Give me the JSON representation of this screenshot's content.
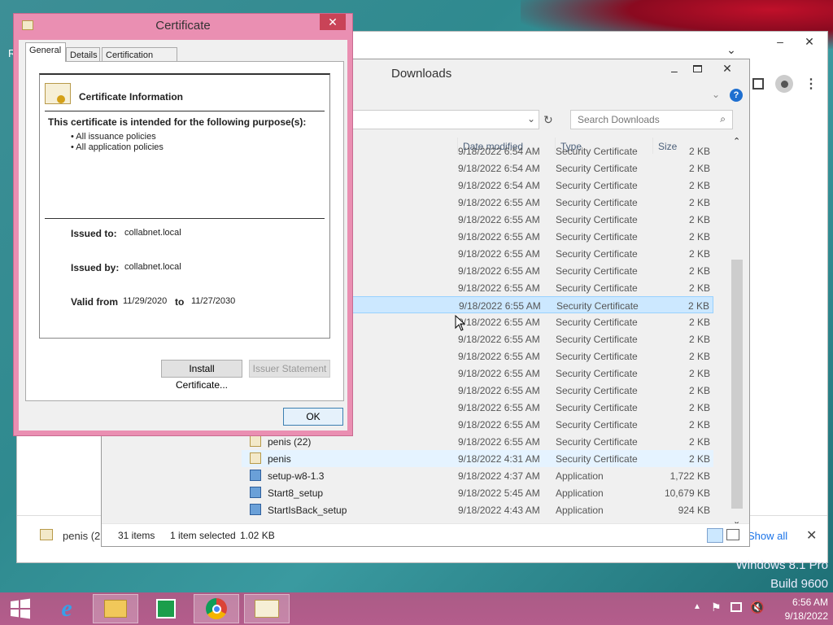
{
  "desktop": {
    "left_letter": "R",
    "edition": "Windows 8.1 Pro",
    "build": "Build 9600"
  },
  "chrome": {
    "download_shelf": {
      "file_name": "penis (2",
      "show_all": "Show all",
      "close": "✕"
    },
    "menu": "⋮"
  },
  "explorer": {
    "title": "Downloads",
    "search_placeholder": "Search Downloads",
    "columns": {
      "date": "Date modified",
      "type": "Type",
      "size": "Size"
    },
    "rows": [
      {
        "name": "",
        "date": "9/18/2022 6:54 AM",
        "type": "Security Certificate",
        "size": "2 KB"
      },
      {
        "name": "",
        "date": "9/18/2022 6:54 AM",
        "type": "Security Certificate",
        "size": "2 KB"
      },
      {
        "name": "",
        "date": "9/18/2022 6:54 AM",
        "type": "Security Certificate",
        "size": "2 KB"
      },
      {
        "name": "",
        "date": "9/18/2022 6:55 AM",
        "type": "Security Certificate",
        "size": "2 KB"
      },
      {
        "name": "",
        "date": "9/18/2022 6:55 AM",
        "type": "Security Certificate",
        "size": "2 KB"
      },
      {
        "name": "",
        "date": "9/18/2022 6:55 AM",
        "type": "Security Certificate",
        "size": "2 KB"
      },
      {
        "name": "",
        "date": "9/18/2022 6:55 AM",
        "type": "Security Certificate",
        "size": "2 KB"
      },
      {
        "name": "",
        "date": "9/18/2022 6:55 AM",
        "type": "Security Certificate",
        "size": "2 KB"
      },
      {
        "name": "",
        "date": "9/18/2022 6:55 AM",
        "type": "Security Certificate",
        "size": "2 KB"
      },
      {
        "name": "",
        "date": "9/18/2022 6:55 AM",
        "type": "Security Certificate",
        "size": "2 KB"
      },
      {
        "name": "",
        "date": "9/18/2022 6:55 AM",
        "type": "Security Certificate",
        "size": "2 KB"
      },
      {
        "name": "",
        "date": "9/18/2022 6:55 AM",
        "type": "Security Certificate",
        "size": "2 KB"
      },
      {
        "name": "",
        "date": "9/18/2022 6:55 AM",
        "type": "Security Certificate",
        "size": "2 KB"
      },
      {
        "name": "",
        "date": "9/18/2022 6:55 AM",
        "type": "Security Certificate",
        "size": "2 KB"
      },
      {
        "name": "",
        "date": "9/18/2022 6:55 AM",
        "type": "Security Certificate",
        "size": "2 KB"
      },
      {
        "name": "",
        "date": "9/18/2022 6:55 AM",
        "type": "Security Certificate",
        "size": "2 KB"
      },
      {
        "name": "",
        "date": "9/18/2022 6:55 AM",
        "type": "Security Certificate",
        "size": "2 KB"
      },
      {
        "name": "penis (22)",
        "date": "9/18/2022 6:55 AM",
        "type": "Security Certificate",
        "size": "2 KB"
      },
      {
        "name": "penis",
        "date": "9/18/2022 4:31 AM",
        "type": "Security Certificate",
        "size": "2 KB"
      },
      {
        "name": "setup-w8-1.3",
        "date": "9/18/2022 4:37 AM",
        "type": "Application",
        "size": "1,722 KB"
      },
      {
        "name": "Start8_setup",
        "date": "9/18/2022 5:45 AM",
        "type": "Application",
        "size": "10,679 KB"
      },
      {
        "name": "StartIsBack_setup",
        "date": "9/18/2022 4:43 AM",
        "type": "Application",
        "size": "924 KB"
      }
    ],
    "status": {
      "count": "31 items",
      "selection": "1 item selected",
      "size": "1.02 KB"
    }
  },
  "cert": {
    "title": "Certificate",
    "close": "✕",
    "tabs": [
      "General",
      "Details",
      "Certification Path"
    ],
    "heading": "Certificate Information",
    "purpose_heading": "This certificate is intended for the following purpose(s):",
    "purposes": [
      "• All issuance policies",
      "• All application policies"
    ],
    "issued_to_label": "Issued to:",
    "issued_to": "collabnet.local",
    "issued_by_label": "Issued by:",
    "issued_by": "collabnet.local",
    "valid_from_label": "Valid from",
    "valid_from": "11/29/2020",
    "to_label": "to",
    "valid_to": "11/27/2030",
    "install_button": "Install Certificate...",
    "issuer_button": "Issuer Statement",
    "ok_button": "OK"
  },
  "tray": {
    "time": "6:56 AM",
    "date": "9/18/2022"
  }
}
